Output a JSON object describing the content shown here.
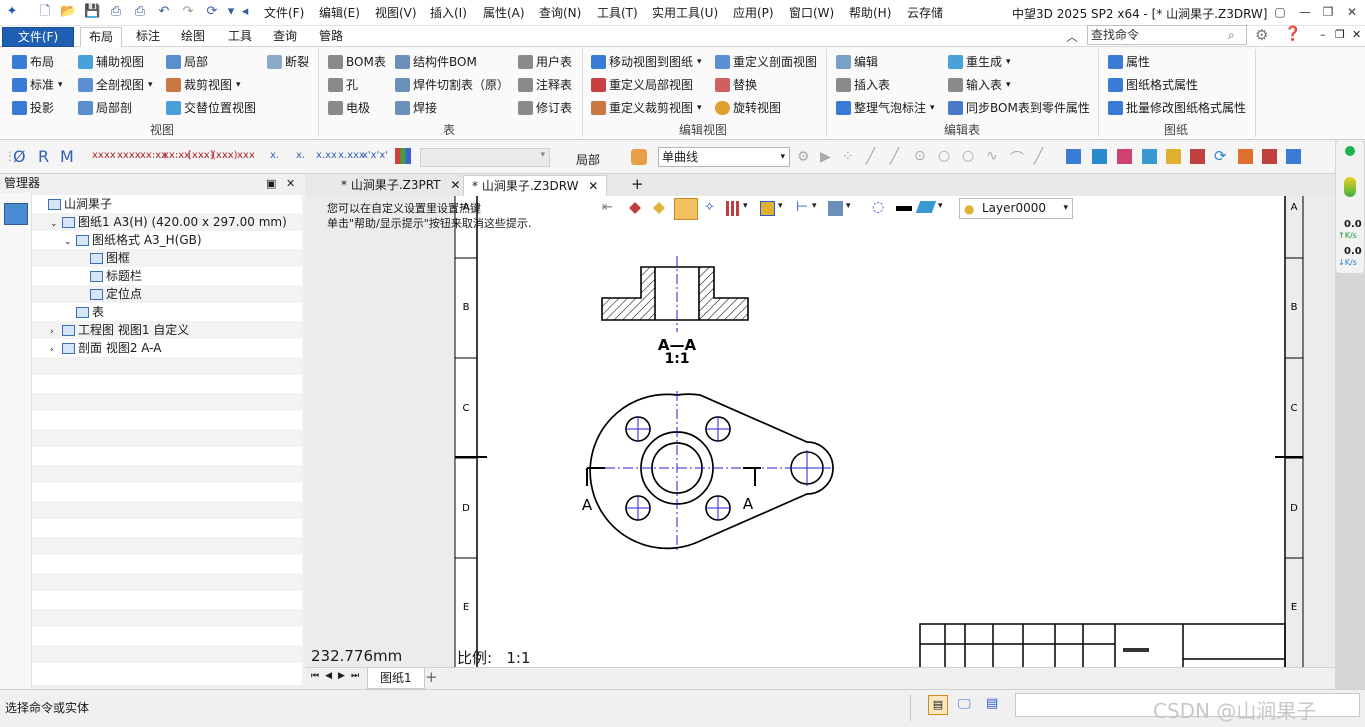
{
  "app": {
    "title": "中望3D 2025 SP2 x64 - [* 山涧果子.Z3DRW]"
  },
  "menu": [
    "文件(F)",
    "编辑(E)",
    "视图(V)",
    "插入(I)",
    "属性(A)",
    "查询(N)",
    "工具(T)",
    "实用工具(U)",
    "应用(P)",
    "窗口(W)",
    "帮助(H)",
    "云存储"
  ],
  "ribbon_tabs": [
    "文件(F)",
    "布局",
    "标注",
    "绘图",
    "工具",
    "查询",
    "管路"
  ],
  "search": {
    "placeholder": "查找命令"
  },
  "ribbon": {
    "view": {
      "label": "视图",
      "items": [
        "布局",
        "辅助视图",
        "局部",
        "断裂",
        "标准",
        "全剖视图",
        "裁剪视图",
        "投影",
        "局部剖",
        "交替位置视图"
      ]
    },
    "table": {
      "label": "表",
      "items": [
        "BOM表",
        "结构件BOM",
        "用户表",
        "孔",
        "焊件切割表（原）",
        "注释表",
        "电极",
        "焊接",
        "修订表"
      ]
    },
    "editview": {
      "label": "编辑视图",
      "items": [
        "移动视图到图纸",
        "重定义剖面视图",
        "重定义局部视图",
        "替换",
        "重定义裁剪视图",
        "旋转视图"
      ]
    },
    "edittable": {
      "label": "编辑表",
      "items": [
        "编辑",
        "重生成",
        "插入表",
        "输入表",
        "整理气泡标注",
        "同步BOM表到零件属性"
      ]
    },
    "sheet": {
      "label": "图纸",
      "items": [
        "属性",
        "图纸格式属性",
        "批量修改图纸格式属性"
      ]
    }
  },
  "toolbar2": {
    "letters": [
      "Ø",
      "R",
      "M"
    ],
    "combo_label": "局部",
    "curve_type": "单曲线"
  },
  "manager": {
    "title": "管理器",
    "tree": [
      {
        "label": "山涧果子",
        "indent": 0
      },
      {
        "label": "图纸1 A3(H) (420.00 x 297.00 mm)",
        "indent": 1
      },
      {
        "label": "图纸格式 A3_H(GB)",
        "indent": 2
      },
      {
        "label": "图框",
        "indent": 3
      },
      {
        "label": "标题栏",
        "indent": 3
      },
      {
        "label": "定位点",
        "indent": 3
      },
      {
        "label": "表",
        "indent": 2
      },
      {
        "label": "工程图 视图1 自定义",
        "indent": 1
      },
      {
        "label": "剖面 视图2 A-A",
        "indent": 1
      }
    ]
  },
  "doc_tabs": [
    "* 山涧果子.Z3PRT",
    "* 山涧果子.Z3DRW"
  ],
  "canvas": {
    "tip1": "您可以在自定义设置里设置热键",
    "tip2": "单击\"帮助/显示提示\"按钮来取消这些提示.",
    "layer": "Layer0000",
    "readout": "232.776mm",
    "scale_label": "比例:",
    "scale_value": "1:1",
    "section_label": "A—A",
    "section_scale": "1:1",
    "cut_left": "A",
    "cut_right": "A",
    "zone_labels": [
      "A",
      "B",
      "C",
      "D",
      "E"
    ]
  },
  "sheet_tabs": [
    "图纸1"
  ],
  "netpanel": {
    "up": "0.0",
    "up_unit": "K/s",
    "down": "0.0",
    "down_unit": "K/s"
  },
  "status": {
    "text": "选择命令或实体",
    "watermark": "CSDN @山涧果子"
  },
  "colors": {
    "accent": "#1e5fb4",
    "centerline": "#2020d0",
    "drawing": "#000000"
  }
}
